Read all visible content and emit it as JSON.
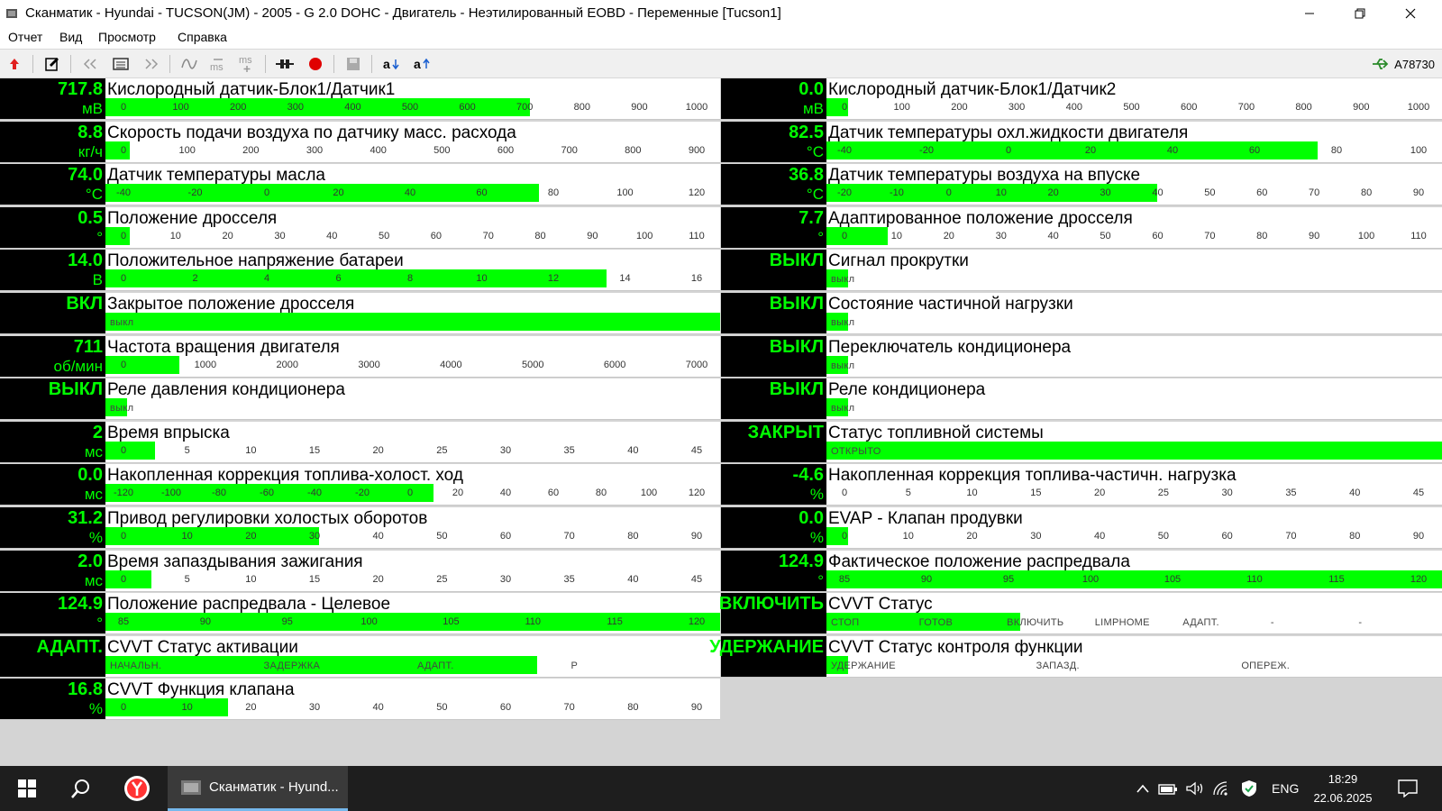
{
  "window": {
    "title": "Сканматик - Hyundai - TUCSON(JM) - 2005 - G 2.0 DOHC - Двигатель - Неэтилированный EOBD - Переменные [Tucson1]",
    "menu": [
      "Отчет",
      "Вид",
      "Просмотр",
      "Справка"
    ]
  },
  "toolbar": {
    "device": "A78730",
    "icons": [
      "exit-arrow-icon",
      "report-edit-icon",
      "prev-icon",
      "list-icon",
      "next-icon",
      "wave-icon",
      "ms-minus-icon",
      "ms-plus-icon",
      "connector-icon",
      "record-icon",
      "save-icon",
      "sort-asc-icon",
      "sort-desc-icon"
    ]
  },
  "colors": {
    "value_bg": "#000000",
    "value_text": "#00ff00",
    "bar_fill": "#00ff00",
    "cell_bg": "#ffffff",
    "grid_bg": "#d4d4d4"
  },
  "parameters": {
    "left": [
      {
        "value": "717.8",
        "unit": "мВ",
        "name": "Кислородный датчик-Блок1/Датчик1",
        "ticks": [
          "0",
          "100",
          "200",
          "300",
          "400",
          "500",
          "600",
          "700",
          "800",
          "900",
          "1000"
        ],
        "fill": 0.69
      },
      {
        "value": "8.8",
        "unit": "кг/ч",
        "name": "Скорость подачи воздуха по датчику масс. расхода",
        "ticks": [
          "0",
          "100",
          "200",
          "300",
          "400",
          "500",
          "600",
          "700",
          "800",
          "900"
        ],
        "fill": 0.04
      },
      {
        "value": "74.0",
        "unit": "°C",
        "name": "Датчик температуры масла",
        "ticks": [
          "-40",
          "-20",
          "0",
          "20",
          "40",
          "60",
          "80",
          "100",
          "120"
        ],
        "fill": 0.706
      },
      {
        "value": "0.5",
        "unit": "°",
        "name": "Положение дросселя",
        "ticks": [
          "0",
          "10",
          "20",
          "30",
          "40",
          "50",
          "60",
          "70",
          "80",
          "90",
          "100",
          "110"
        ],
        "fill": 0.04
      },
      {
        "value": "14.0",
        "unit": "В",
        "name": "Положительное напряжение батареи",
        "ticks": [
          "0",
          "2",
          "4",
          "6",
          "8",
          "10",
          "12",
          "14",
          "16"
        ],
        "fill": 0.815
      },
      {
        "value": "ВКЛ",
        "unit": "",
        "name": "Закрытое положение дросселя",
        "states": [
          "выкл"
        ],
        "fill": 1.0
      },
      {
        "value": "711",
        "unit": "об/мин",
        "name": "Частота вращения двигателя",
        "ticks": [
          "0",
          "1000",
          "2000",
          "3000",
          "4000",
          "5000",
          "6000",
          "7000"
        ],
        "fill": 0.12
      },
      {
        "value": "ВЫКЛ",
        "unit": "",
        "name": "Реле давления кондиционера",
        "states": [
          "выкл"
        ],
        "fill": 0.035
      },
      {
        "value": "2",
        "unit": "мс",
        "name": "Время впрыска",
        "ticks": [
          "0",
          "5",
          "10",
          "15",
          "20",
          "25",
          "30",
          "35",
          "40",
          "45"
        ],
        "fill": 0.08
      },
      {
        "value": "0.0",
        "unit": "мс",
        "name": "Накопленная коррекция топлива-холост. ход",
        "ticks": [
          "-120",
          "-100",
          "-80",
          "-60",
          "-40",
          "-20",
          "0",
          "20",
          "40",
          "60",
          "80",
          "100",
          "120"
        ],
        "fill": 0.534
      },
      {
        "value": "31.2",
        "unit": "%",
        "name": "Привод регулировки холостых оборотов",
        "ticks": [
          "0",
          "10",
          "20",
          "30",
          "40",
          "50",
          "60",
          "70",
          "80",
          "90"
        ],
        "fill": 0.348
      },
      {
        "value": "2.0",
        "unit": "мс",
        "name": "Время запаздывания зажигания",
        "ticks": [
          "0",
          "5",
          "10",
          "15",
          "20",
          "25",
          "30",
          "35",
          "40",
          "45"
        ],
        "fill": 0.075
      },
      {
        "value": "124.9",
        "unit": "°",
        "name": "Положение распредвала - Целевое",
        "ticks": [
          "85",
          "90",
          "95",
          "100",
          "105",
          "110",
          "115",
          "120"
        ],
        "fill": 1.0
      },
      {
        "value": "АДАПТ.",
        "unit": "",
        "name": "CVVT Статус активации",
        "states": [
          "НАЧАЛЬН.",
          "ЗАДЕРЖКА",
          "АДАПТ.",
          "Р"
        ],
        "fill": 0.703
      },
      {
        "value": "16.8",
        "unit": "%",
        "name": "CVVT Функция клапана",
        "ticks": [
          "0",
          "10",
          "20",
          "30",
          "40",
          "50",
          "60",
          "70",
          "80",
          "90"
        ],
        "fill": 0.2
      }
    ],
    "right": [
      {
        "value": "0.0",
        "unit": "мВ",
        "name": "Кислородный датчик-Блок1/Датчик2",
        "ticks": [
          "0",
          "100",
          "200",
          "300",
          "400",
          "500",
          "600",
          "700",
          "800",
          "900",
          "1000"
        ],
        "fill": 0.035
      },
      {
        "value": "82.5",
        "unit": "°C",
        "name": "Датчик температуры охл.жидкости двигателя",
        "ticks": [
          "-40",
          "-20",
          "0",
          "20",
          "40",
          "60",
          "80",
          "100"
        ],
        "fill": 0.798
      },
      {
        "value": "36.8",
        "unit": "°C",
        "name": "Датчик температуры воздуха на впуске",
        "ticks": [
          "-20",
          "-10",
          "0",
          "10",
          "20",
          "30",
          "40",
          "50",
          "60",
          "70",
          "80",
          "90"
        ],
        "fill": 0.538
      },
      {
        "value": "7.7",
        "unit": "°",
        "name": "Адаптированное положение дросселя",
        "ticks": [
          "0",
          "10",
          "20",
          "30",
          "40",
          "50",
          "60",
          "70",
          "80",
          "90",
          "100",
          "110"
        ],
        "fill": 0.099
      },
      {
        "value": "ВЫКЛ",
        "unit": "",
        "name": "Сигнал прокрутки",
        "states": [
          "выкл"
        ],
        "fill": 0.035
      },
      {
        "value": "ВЫКЛ",
        "unit": "",
        "name": "Состояние частичной нагрузки",
        "states": [
          "выкл"
        ],
        "fill": 0.035
      },
      {
        "value": "ВЫКЛ",
        "unit": "",
        "name": "Переключатель кондиционера",
        "states": [
          "выкл"
        ],
        "fill": 0.035
      },
      {
        "value": "ВЫКЛ",
        "unit": "",
        "name": "Реле кондиционера",
        "states": [
          "выкл"
        ],
        "fill": 0.035
      },
      {
        "value": "ЗАКРЫТ",
        "unit": "",
        "name": "Статус топливной системы",
        "states": [
          "ОТКРЫТО"
        ],
        "fill": 1.0
      },
      {
        "value": "-4.6",
        "unit": "%",
        "name": "Накопленная коррекция топлива-частичн. нагрузка",
        "ticks": [
          "0",
          "5",
          "10",
          "15",
          "20",
          "25",
          "30",
          "35",
          "40",
          "45"
        ],
        "fill": 0.0
      },
      {
        "value": "0.0",
        "unit": "%",
        "name": "EVAP - Клапан продувки",
        "ticks": [
          "0",
          "10",
          "20",
          "30",
          "40",
          "50",
          "60",
          "70",
          "80",
          "90"
        ],
        "fill": 0.035
      },
      {
        "value": "124.9",
        "unit": "°",
        "name": "Фактическое положение распредвала",
        "ticks": [
          "85",
          "90",
          "95",
          "100",
          "105",
          "110",
          "115",
          "120"
        ],
        "fill": 1.0
      },
      {
        "value": "ВКЛЮЧИТЬ",
        "unit": "",
        "name": "CVVT Статус",
        "states": [
          "СТОП",
          "ГОТОВ",
          "ВКЛЮЧИТЬ",
          "LIMPHOME",
          "АДАПТ.",
          "-",
          "-"
        ],
        "fill": 0.315
      },
      {
        "value": "УДЕРЖАНИЕ",
        "unit": "",
        "name": "CVVT Статус контроля функции",
        "states": [
          "УДЕРЖАНИЕ",
          "ЗАПАЗД.",
          "ОПЕРЕЖ."
        ],
        "fill": 0.035
      }
    ]
  },
  "taskbar": {
    "app_label": "Сканматик - Hyund...",
    "lang": "ENG",
    "time": "18:29",
    "date": "22.06.2025"
  }
}
